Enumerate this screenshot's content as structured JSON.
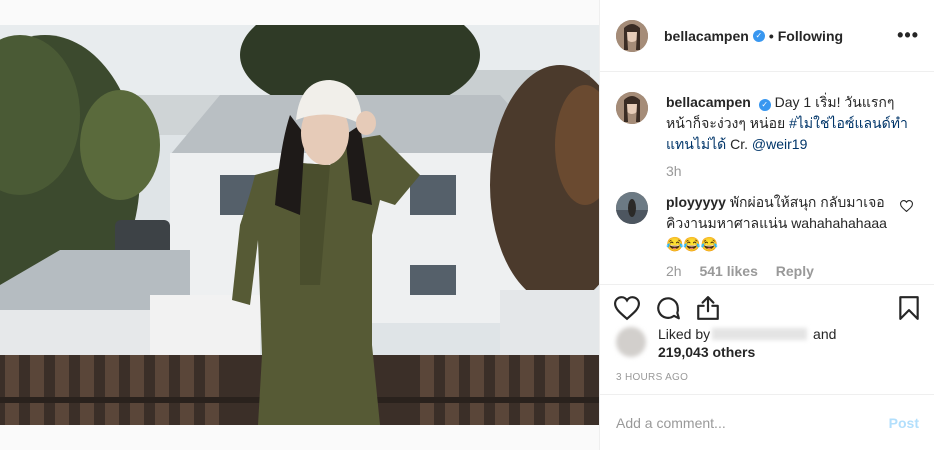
{
  "post": {
    "username": "bellacampen",
    "separator": "•",
    "follow_status": "Following",
    "more_glyph": "•••",
    "verified_glyph": "✓"
  },
  "caption": {
    "username": "bellacampen",
    "text_before": " Day 1 เริ่ม! วันแรกๆ หน้าก็จะง่วงๆ หน่อย ",
    "hashtag": "#ไม่ใช่ไอซ์แลนด์ทำแทนไม่ได้",
    "text_mid": " Cr. ",
    "mention": "@weir19",
    "time": "3h"
  },
  "comment": {
    "username": "ployyyyy",
    "text": " พักผ่อนให้สนุก กลับมาเจอคิวงานมหาศาลแน่น wahahahahaaa😂😂😂",
    "time": "2h",
    "likes": "541 likes",
    "reply": "Reply"
  },
  "likes": {
    "prefix": "Liked by",
    "suffix": " and",
    "count": "219,043 others"
  },
  "timestamp": "3 HOURS AGO",
  "add_comment": {
    "placeholder": "Add a comment...",
    "post_label": "Post"
  },
  "icons": [
    "heart-icon",
    "comment-icon",
    "share-icon",
    "bookmark-icon",
    "more-options-icon",
    "verified-icon"
  ],
  "colors": {
    "link": "#003569",
    "verified": "#3897f0",
    "post_disabled": "#b2dffc",
    "muted": "#999999"
  }
}
